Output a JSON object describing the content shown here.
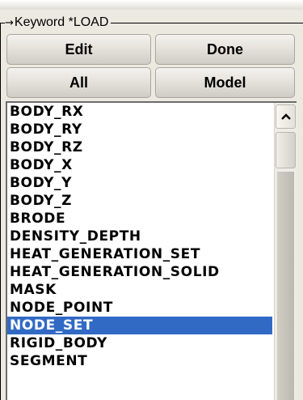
{
  "group": {
    "title": "Keyword *LOAD",
    "arrow_icon": "arrow-right-icon"
  },
  "buttons": {
    "edit": "Edit",
    "done": "Done",
    "all": "All",
    "model": "Model"
  },
  "list": {
    "items": [
      "BODY_RX",
      "BODY_RY",
      "BODY_RZ",
      "BODY_X",
      "BODY_Y",
      "BODY_Z",
      "BRODE",
      "DENSITY_DEPTH",
      "HEAT_GENERATION_SET",
      "HEAT_GENERATION_SOLID",
      "MASK",
      "NODE_POINT",
      "NODE_SET",
      "RIGID_BODY",
      "SEGMENT"
    ],
    "selected_item": "NODE_SET"
  },
  "scrollbar": {
    "up_icon": "chevron-up-icon"
  },
  "colors": {
    "selection": "#316ac5",
    "panel": "#ece9e1"
  }
}
